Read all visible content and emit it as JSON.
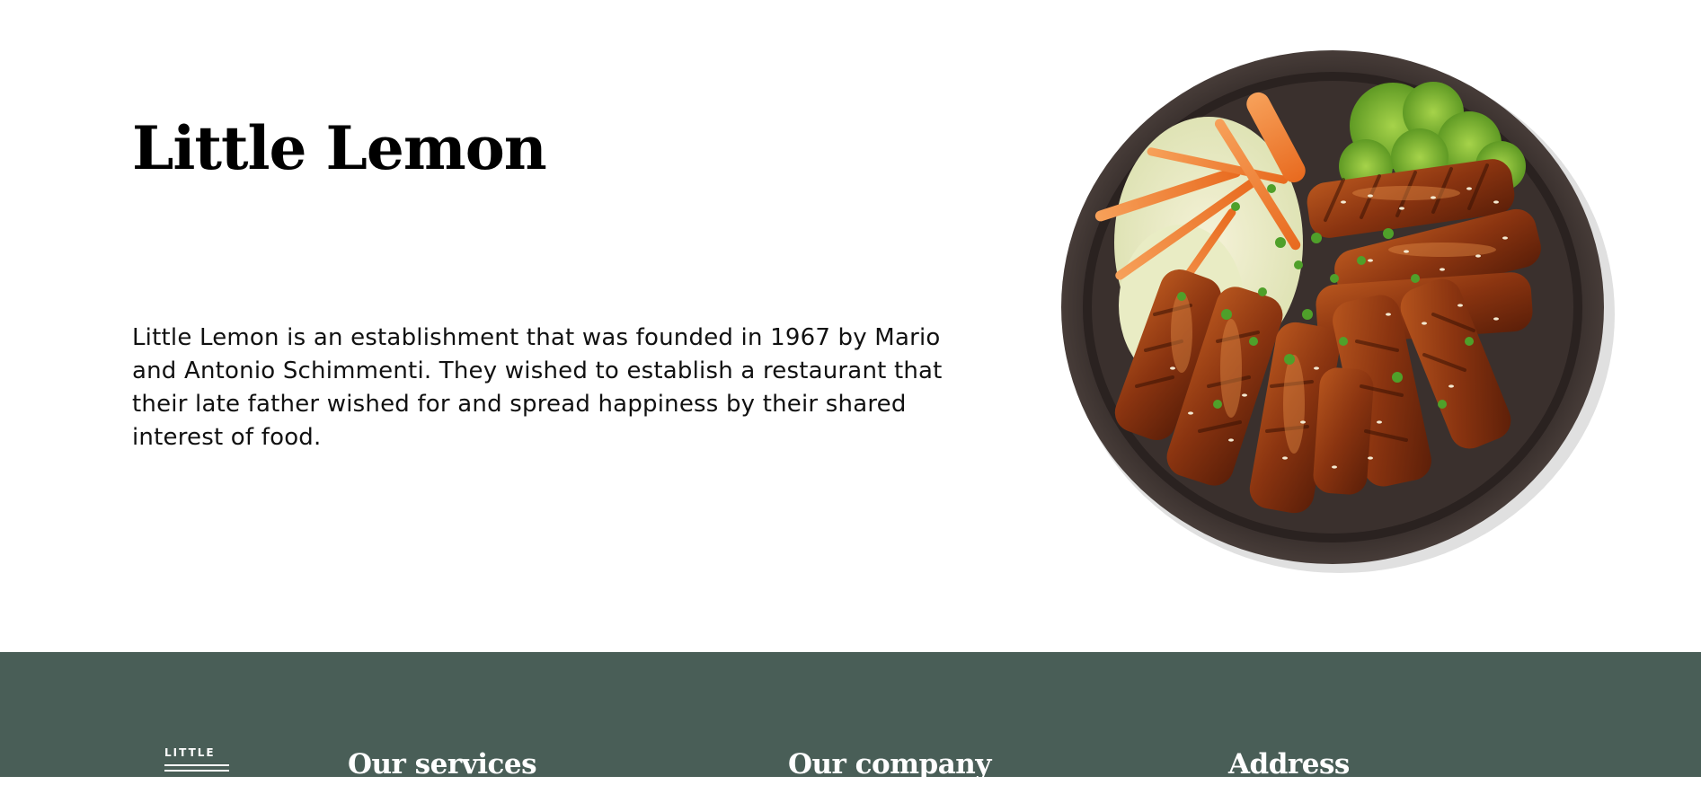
{
  "about": {
    "title": "Little Lemon",
    "description": "Little Lemon is an establishment that was founded in 1967 by Mario and Antonio Schimmenti. They wished to establish a restaurant that their late father wished for and spread happiness by their shared interest of food."
  },
  "footer": {
    "logo_text": "LITTLE",
    "services_heading": "Our services",
    "company_heading": "Our company",
    "address_heading": "Address"
  },
  "colors": {
    "footer_background": "#495E57",
    "footer_text": "#FFFFFF",
    "page_background": "#FFFFFF"
  }
}
